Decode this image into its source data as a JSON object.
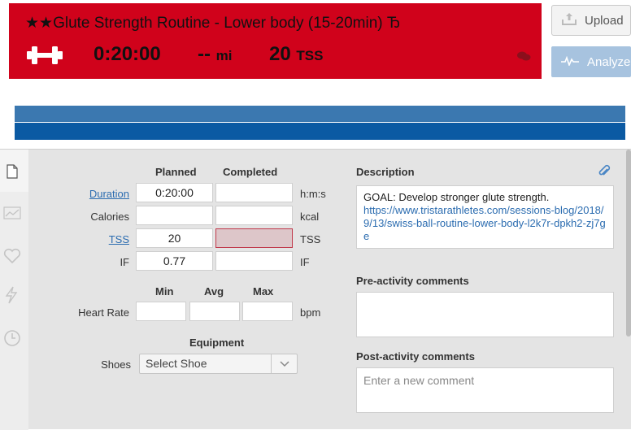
{
  "workout": {
    "title": "★★Glute Strength Routine - Lower body (15-20min) Ђ",
    "duration": "0:20:00",
    "distance": "--",
    "distance_unit": "mi",
    "tss": "20",
    "tss_unit": "TSS",
    "icon": "dumbbell-icon",
    "colors": {
      "header": "#d0021b",
      "bar_light": "#3b78b0",
      "bar_dark": "#0b5aa3"
    }
  },
  "buttons": {
    "upload": "Upload",
    "analyze": "Analyze"
  },
  "rail_icons": [
    "document-icon",
    "chart-line-icon",
    "heart-icon",
    "lightning-icon",
    "clock-icon"
  ],
  "metrics": {
    "headers": {
      "planned": "Planned",
      "completed": "Completed"
    },
    "rows": [
      {
        "label": "Duration",
        "planned": "0:20:00",
        "completed": "",
        "unit": "h:m:s"
      },
      {
        "label": "Calories",
        "planned": "",
        "completed": "",
        "unit": "kcal"
      },
      {
        "label": "TSS",
        "planned": "20",
        "completed": "",
        "unit": "TSS"
      },
      {
        "label": "IF",
        "planned": "0.77",
        "completed": "",
        "unit": "IF"
      }
    ]
  },
  "heart_rate": {
    "headers": {
      "min": "Min",
      "avg": "Avg",
      "max": "Max"
    },
    "label": "Heart Rate",
    "min": "",
    "avg": "",
    "max": "",
    "unit": "bpm"
  },
  "equipment": {
    "title": "Equipment",
    "shoes_label": "Shoes",
    "shoes_value": "Select Shoe"
  },
  "description": {
    "title": "Description",
    "text": "GOAL: Develop stronger glute strength.",
    "url": "https://www.tristarathletes.com/sessions-blog/2018/9/13/swiss-ball-routine-lower-body-l2k7r-dpkh2-zj7ge"
  },
  "pre_comments": {
    "title": "Pre-activity comments"
  },
  "post_comments": {
    "title": "Post-activity comments",
    "placeholder": "Enter a new comment"
  }
}
